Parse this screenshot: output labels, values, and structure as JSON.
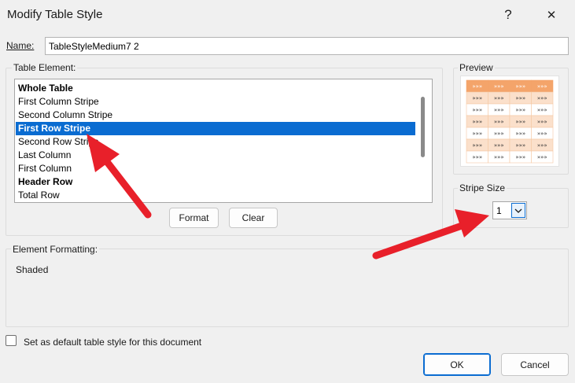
{
  "window": {
    "title": "Modify Table Style",
    "help_glyph": "?",
    "close_glyph": "✕"
  },
  "name": {
    "label": "Name:",
    "value": "TableStyleMedium7 2"
  },
  "table_element": {
    "label": "Table Element:",
    "items": [
      {
        "label": "Whole Table",
        "bold": true,
        "selected": false
      },
      {
        "label": "First Column Stripe",
        "bold": false,
        "selected": false
      },
      {
        "label": "Second Column Stripe",
        "bold": false,
        "selected": false
      },
      {
        "label": "First Row Stripe",
        "bold": true,
        "selected": true
      },
      {
        "label": "Second Row Stripe",
        "bold": false,
        "selected": false
      },
      {
        "label": "Last Column",
        "bold": false,
        "selected": false
      },
      {
        "label": "First Column",
        "bold": false,
        "selected": false
      },
      {
        "label": "Header Row",
        "bold": true,
        "selected": false
      },
      {
        "label": "Total Row",
        "bold": false,
        "selected": false
      }
    ]
  },
  "buttons": {
    "format": "Format",
    "clear": "Clear",
    "ok": "OK",
    "cancel": "Cancel"
  },
  "preview": {
    "label": "Preview",
    "header_color": "#f4a46a",
    "stripe_color": "#fbe0cb",
    "cell_glyph": "»»»"
  },
  "stripe_size": {
    "label": "Stripe Size",
    "value": "1"
  },
  "element_formatting": {
    "label": "Element Formatting:",
    "value": "Shaded"
  },
  "default_checkbox": {
    "label": "Set as default table style for this document",
    "checked": false
  },
  "colors": {
    "selection": "#0a6cd1",
    "annotation_arrow": "#e8202a"
  }
}
